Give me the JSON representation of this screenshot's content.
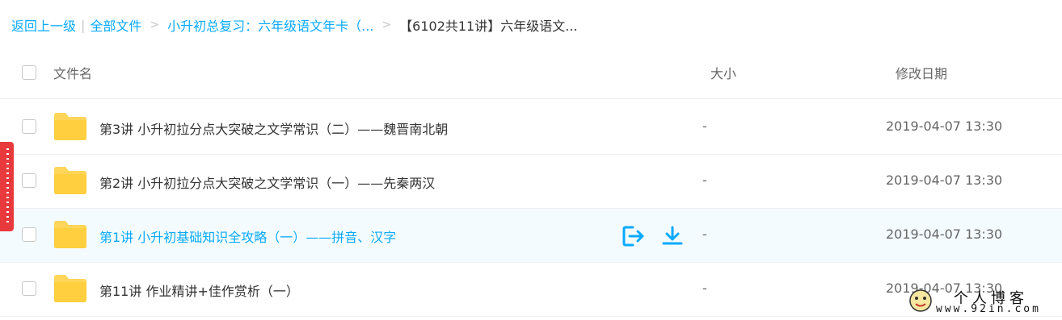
{
  "breadcrumb": {
    "back": "返回上一级",
    "separator": "|",
    "all_files": "全部文件",
    "arrow": ">",
    "folder1": "小升初总复习：六年级语文年卡（...",
    "current": "【6102共11讲】六年级语文..."
  },
  "header": {
    "name": "文件名",
    "size": "大小",
    "date": "修改日期"
  },
  "rows": [
    {
      "name": "第3讲 小升初拉分点大突破之文学常识（二）——魏晋南北朝",
      "size": "-",
      "date": "2019-04-07 13:30"
    },
    {
      "name": "第2讲 小升初拉分点大突破之文学常识（一）——先秦两汉",
      "size": "-",
      "date": "2019-04-07 13:30"
    },
    {
      "name": "第1讲 小升初基础知识全攻略（一）——拼音、汉字",
      "size": "-",
      "date": "2019-04-07 13:30"
    },
    {
      "name": "第11讲 作业精讲+佳作赏析（一）",
      "size": "-",
      "date": "2019-04-07 13:30"
    }
  ],
  "row_actions": {
    "share_icon": "share-icon",
    "download_icon": "download-icon"
  },
  "watermark": {
    "title": "个人博客",
    "url": "www.92in.com"
  },
  "colors": {
    "accent": "#09aaff",
    "folder": "#ffd659",
    "hover_row": "#f4fbff",
    "side_tab": "#e8393c"
  }
}
